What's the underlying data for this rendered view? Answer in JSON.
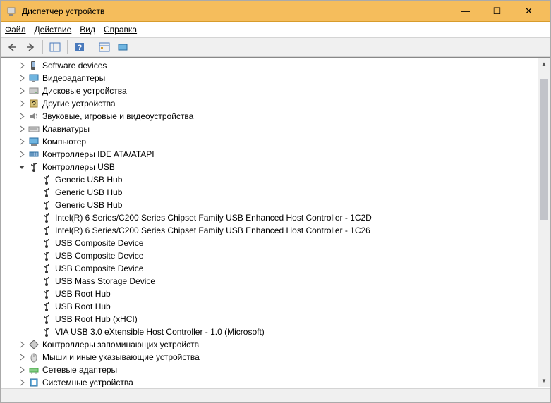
{
  "window": {
    "title": "Диспетчер устройств",
    "minimize_glyph": "—",
    "maximize_glyph": "☐",
    "close_glyph": "✕"
  },
  "menu": {
    "file": "Файл",
    "action": "Действие",
    "view": "Вид",
    "help": "Справка"
  },
  "tree": {
    "items": [
      {
        "indent": 1,
        "arrow": ">",
        "icon": "software",
        "label": "Software devices"
      },
      {
        "indent": 1,
        "arrow": ">",
        "icon": "monitor",
        "label": "Видеоадаптеры"
      },
      {
        "indent": 1,
        "arrow": ">",
        "icon": "disk",
        "label": "Дисковые устройства"
      },
      {
        "indent": 1,
        "arrow": ">",
        "icon": "other",
        "label": "Другие устройства"
      },
      {
        "indent": 1,
        "arrow": ">",
        "icon": "audio",
        "label": "Звуковые, игровые и видеоустройства"
      },
      {
        "indent": 1,
        "arrow": ">",
        "icon": "keyboard",
        "label": "Клавиатуры"
      },
      {
        "indent": 1,
        "arrow": ">",
        "icon": "computer",
        "label": "Компьютер"
      },
      {
        "indent": 1,
        "arrow": ">",
        "icon": "ide",
        "label": "Контроллеры IDE ATA/ATAPI"
      },
      {
        "indent": 1,
        "arrow": "v",
        "icon": "usb",
        "label": "Контроллеры USB"
      },
      {
        "indent": 2,
        "arrow": "",
        "icon": "usb",
        "label": "Generic USB Hub"
      },
      {
        "indent": 2,
        "arrow": "",
        "icon": "usb",
        "label": "Generic USB Hub"
      },
      {
        "indent": 2,
        "arrow": "",
        "icon": "usb",
        "label": "Generic USB Hub"
      },
      {
        "indent": 2,
        "arrow": "",
        "icon": "usb",
        "label": "Intel(R) 6 Series/C200 Series Chipset Family USB Enhanced Host Controller - 1C2D"
      },
      {
        "indent": 2,
        "arrow": "",
        "icon": "usb",
        "label": "Intel(R) 6 Series/C200 Series Chipset Family USB Enhanced Host Controller - 1C26"
      },
      {
        "indent": 2,
        "arrow": "",
        "icon": "usb",
        "label": "USB Composite Device"
      },
      {
        "indent": 2,
        "arrow": "",
        "icon": "usb",
        "label": "USB Composite Device"
      },
      {
        "indent": 2,
        "arrow": "",
        "icon": "usb",
        "label": "USB Composite Device"
      },
      {
        "indent": 2,
        "arrow": "",
        "icon": "usb",
        "label": "USB Mass Storage Device"
      },
      {
        "indent": 2,
        "arrow": "",
        "icon": "usb",
        "label": "USB Root Hub"
      },
      {
        "indent": 2,
        "arrow": "",
        "icon": "usb",
        "label": "USB Root Hub"
      },
      {
        "indent": 2,
        "arrow": "",
        "icon": "usb",
        "label": "USB Root Hub (xHCI)"
      },
      {
        "indent": 2,
        "arrow": "",
        "icon": "usb",
        "label": "VIA USB 3.0 eXtensible Host Controller - 1.0 (Microsoft)"
      },
      {
        "indent": 1,
        "arrow": ">",
        "icon": "storage",
        "label": "Контроллеры запоминающих устройств"
      },
      {
        "indent": 1,
        "arrow": ">",
        "icon": "mouse",
        "label": "Мыши и иные указывающие устройства"
      },
      {
        "indent": 1,
        "arrow": ">",
        "icon": "network",
        "label": "Сетевые адаптеры"
      },
      {
        "indent": 1,
        "arrow": ">",
        "icon": "system",
        "label": "Системные устройства"
      }
    ]
  }
}
